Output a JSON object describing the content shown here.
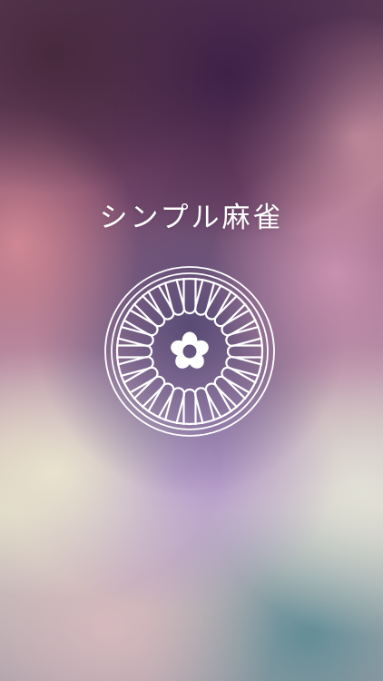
{
  "app": {
    "title": "シンプル麻雀",
    "emblem_icon": "mahjong-dot-tile-emblem-icon",
    "colors": {
      "text": "#ffffff",
      "emblem_stroke": "#ffffff",
      "emblem_fill": "#ffffff"
    }
  }
}
